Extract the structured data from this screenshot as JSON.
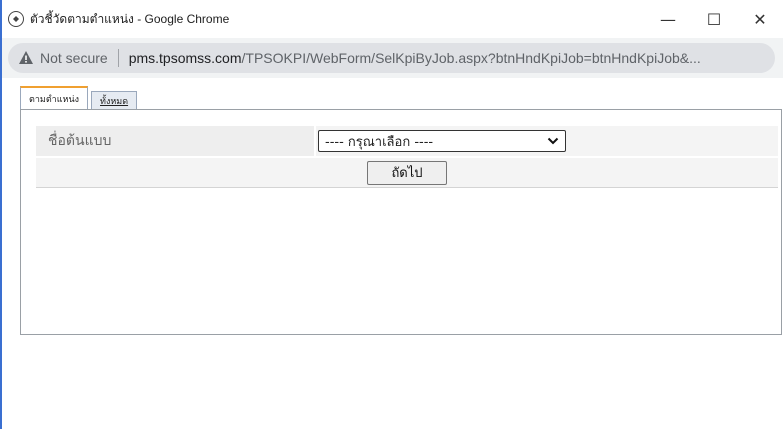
{
  "window": {
    "title": "ตัวชี้วัดตามตำแหน่ง - Google Chrome",
    "minimize_label": "—",
    "maximize_label": "☐",
    "close_label": "✕"
  },
  "address": {
    "security_label": "Not secure",
    "domain": "pms.tpsomss.com",
    "path": "/TPSOKPI/WebForm/SelKpiByJob.aspx?btnHndKpiJob=btnHndKpiJob&..."
  },
  "tabs": [
    {
      "label": "ตามตำแหน่ง",
      "active": true
    },
    {
      "label": "ทั้งหมด",
      "active": false
    }
  ],
  "form": {
    "template_label": "ชื่อต้นแบบ",
    "template_select_value": "---- กรุณาเลือก ----",
    "next_button_label": "ถัดไป"
  },
  "colors": {
    "active_tab_accent": "#f0a030",
    "window_edge": "#3a6fd1"
  }
}
